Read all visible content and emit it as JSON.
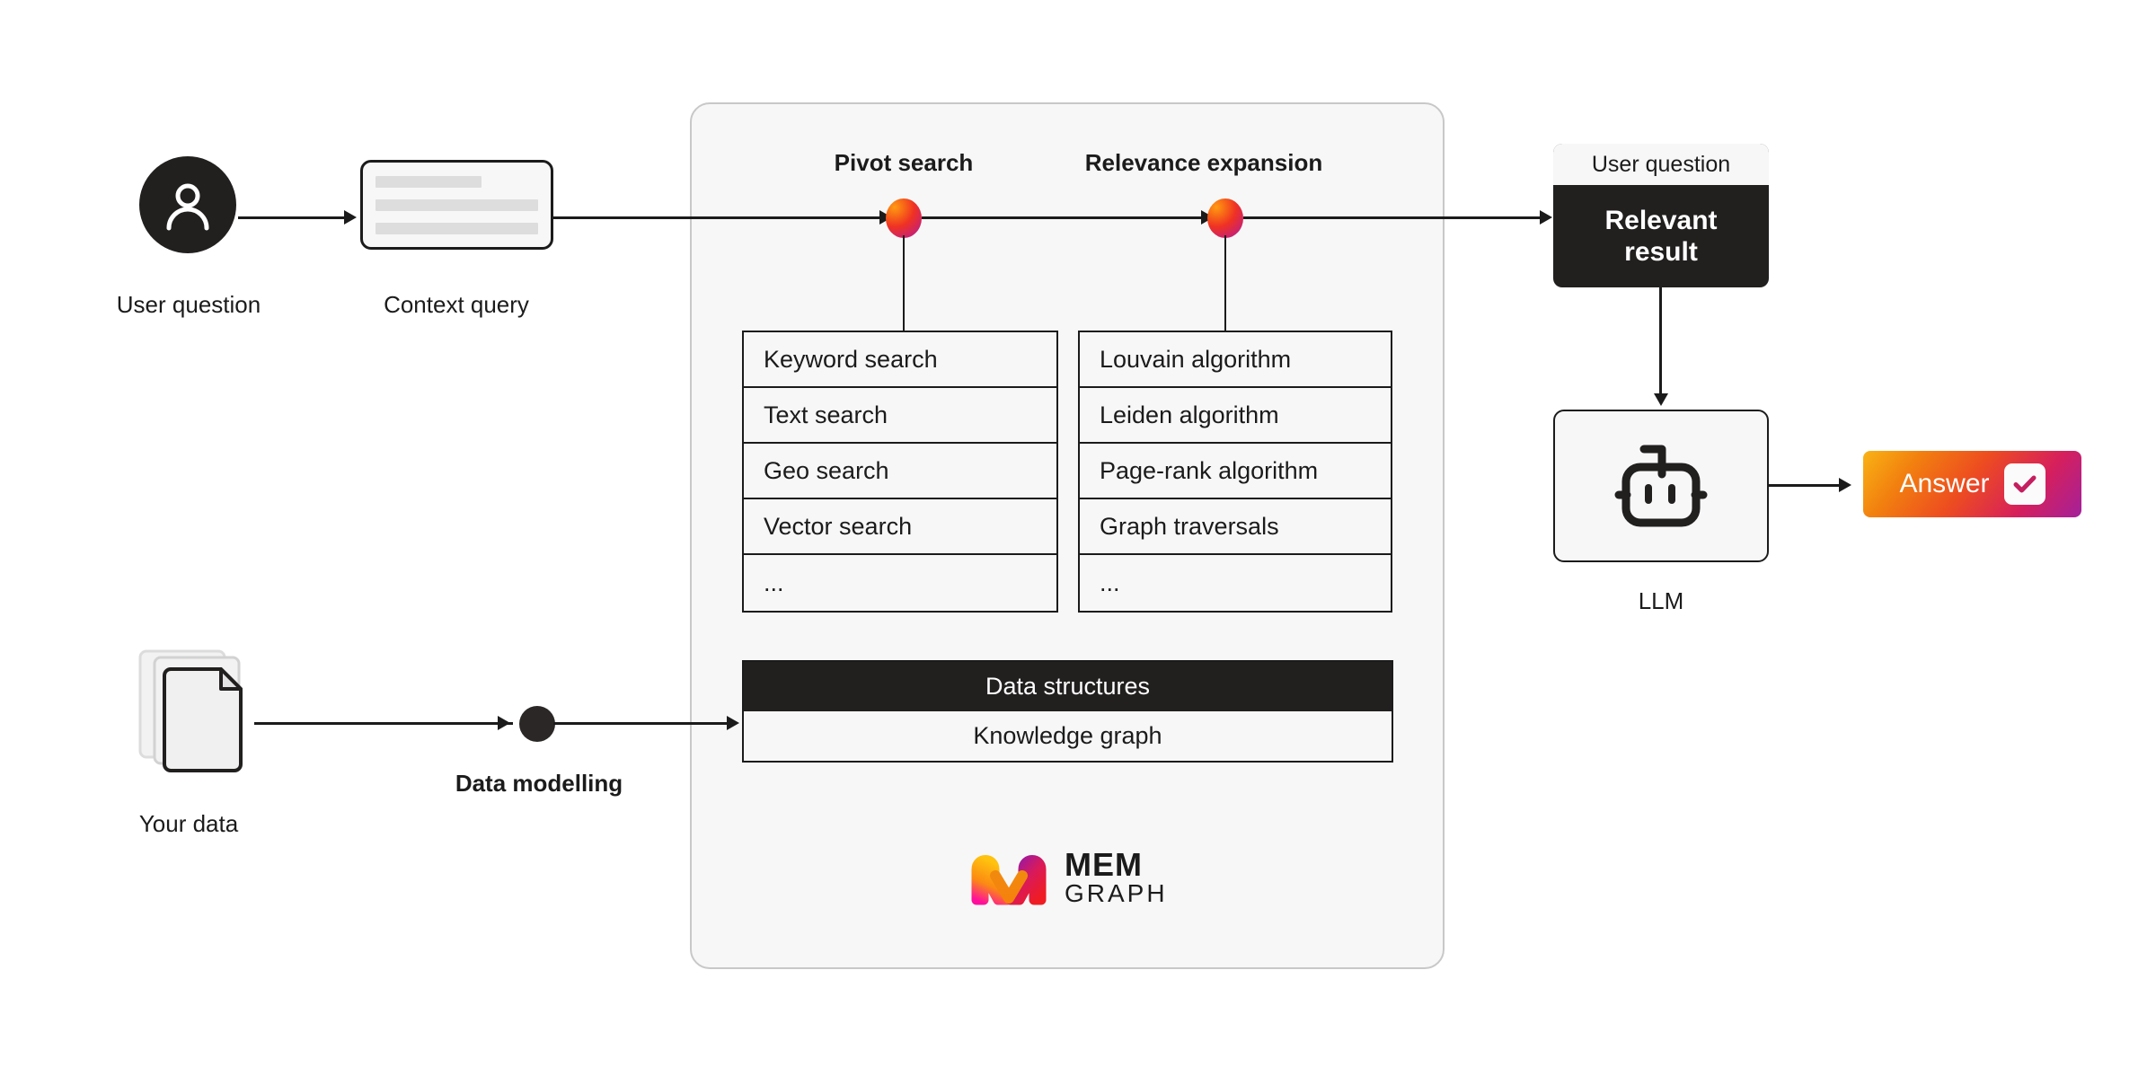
{
  "flow": {
    "user": {
      "label": "User question",
      "icon": "user-avatar-icon"
    },
    "context_query": {
      "label": "Context query",
      "icon": "document-lines-icon"
    },
    "your_data": {
      "label": "Your data",
      "icon": "documents-stack-icon"
    },
    "data_modelling": {
      "label": "Data modelling",
      "icon": "flow-dot-icon"
    }
  },
  "engine": {
    "pivot": {
      "title": "Pivot search",
      "options": [
        "Keyword search",
        "Text search",
        "Geo search",
        "Vector search",
        "..."
      ]
    },
    "relevance": {
      "title": "Relevance expansion",
      "options": [
        "Louvain algorithm",
        "Leiden algorithm",
        "Page-rank algorithm",
        "Graph traversals",
        "..."
      ]
    },
    "data_structures": {
      "header": "Data structures",
      "rows": [
        "Knowledge graph"
      ]
    },
    "logo": {
      "mem": "MEM",
      "graph": "GRAPH",
      "mark": "memgraph-m-logo"
    }
  },
  "output": {
    "result_card": {
      "header": "User question",
      "body": "Relevant\nresult"
    },
    "llm": {
      "label": "LLM",
      "icon": "robot-icon"
    },
    "answer": {
      "label": "Answer",
      "icon": "check-square-icon"
    }
  },
  "colors": {
    "ink": "#1c1b1b",
    "panel_bg": "#f7f7f7",
    "panel_border": "#c8c8c8",
    "dark": "#221f1f",
    "gradient_start": "#f9b315",
    "gradient_mid": "#ed4c20",
    "gradient_end": "#a3219b",
    "check": "#c41f5e"
  }
}
